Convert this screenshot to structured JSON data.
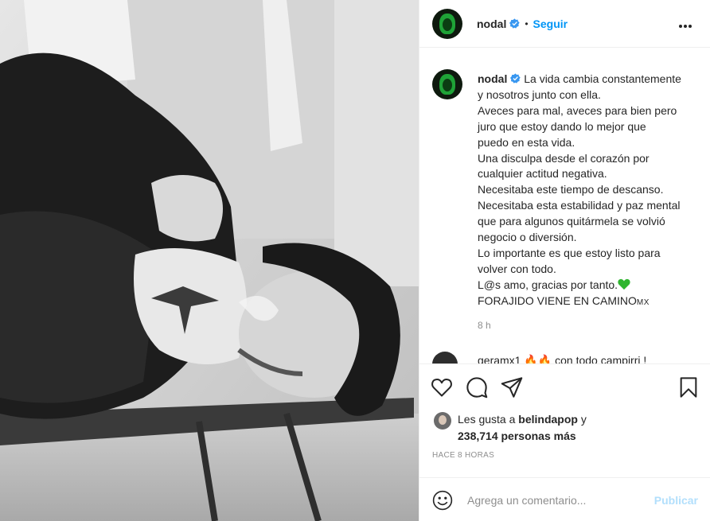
{
  "header": {
    "username": "nodal",
    "dot": "•",
    "follow_label": "Seguir"
  },
  "caption": {
    "username": "nodal",
    "lines": [
      "La vida cambia constantemente",
      "y nosotros junto con ella.",
      "Aveces para mal, aveces para bien pero",
      "juro que estoy dando lo mejor que",
      "puedo en esta vida.",
      "Una disculpa desde el corazón por",
      "cualquier actitud negativa.",
      "Necesitaba este tiempo de descanso.",
      "Necesitaba esta estabilidad y paz mental",
      "que para algunos quitármela se volvió",
      "negocio o diversión.",
      "Lo importante es que estoy listo para",
      "volver con todo.",
      "L@s amo, gracias por tanto.",
      "FORAJIDO VIENE EN CAMINO"
    ],
    "flag_text": "MX",
    "time": "8 h"
  },
  "reply": {
    "text": "geramx1 🔥🔥 con todo campirri !"
  },
  "icons": {
    "verified": "verified-badge-icon",
    "more": "more-options-icon",
    "like": "heart-icon",
    "comment": "comment-icon",
    "share": "share-icon",
    "save": "bookmark-icon",
    "emoji": "emoji-icon",
    "green_heart": "green-heart-emoji"
  },
  "likes": {
    "prefix": "Les gusta a",
    "liker": "belindapop",
    "suffix": "y",
    "count_text": "238,714 personas más"
  },
  "posted": "Hace 8 horas",
  "comment_box": {
    "placeholder": "Agrega un comentario...",
    "publish_label": "Publicar"
  },
  "colors": {
    "link": "#0095f6",
    "verified": "#3897f0",
    "publish_disabled": "#b2dffc",
    "muted": "#8e8e8e",
    "text": "#262626"
  }
}
